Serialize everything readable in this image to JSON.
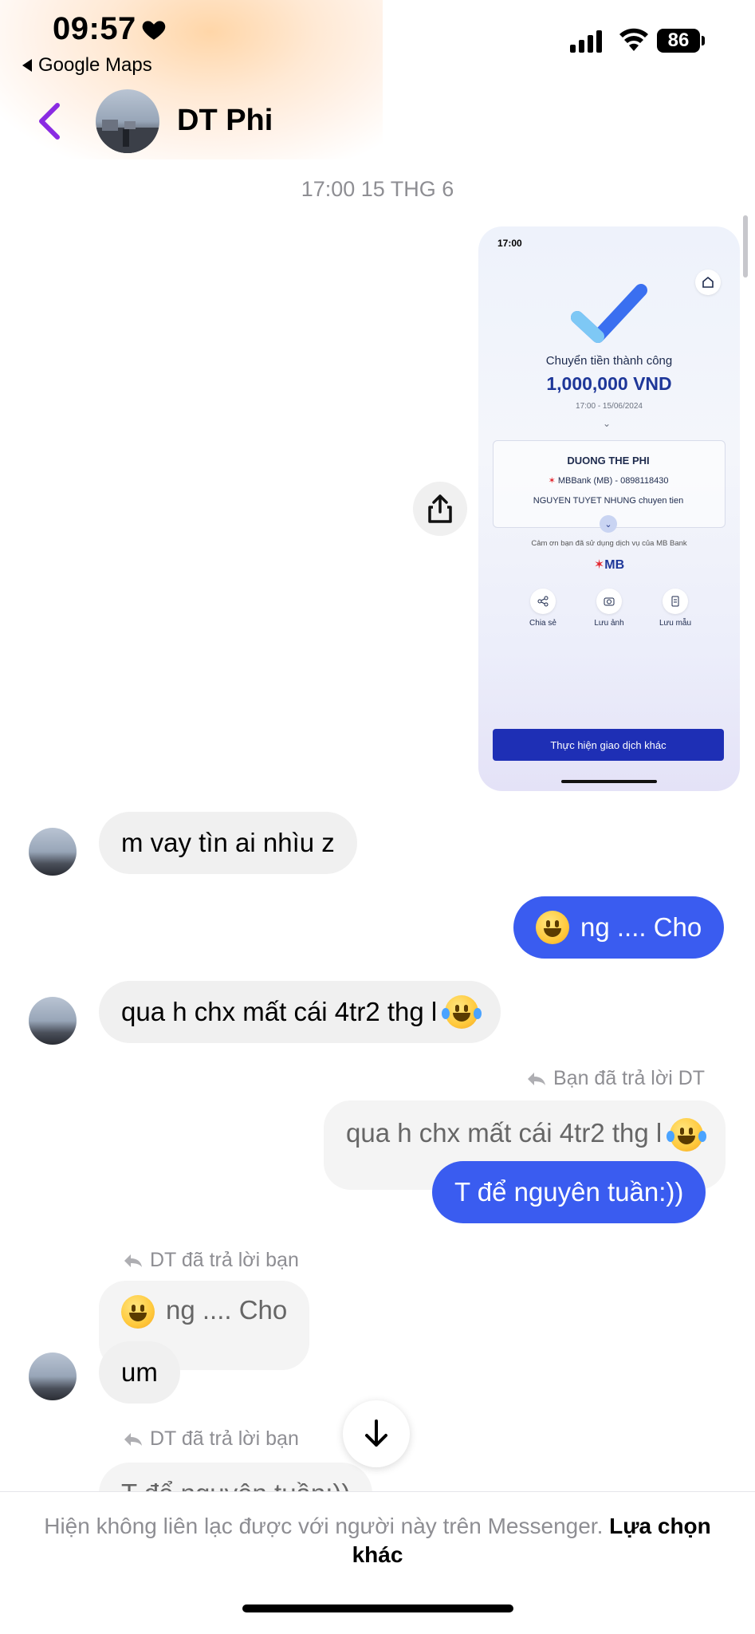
{
  "status_bar": {
    "time": "09:57",
    "back_app": "Google Maps",
    "battery": "86"
  },
  "header": {
    "contact_name": "DT Phi"
  },
  "timestamp": "17:00 15 THG 6",
  "shared_image": {
    "status_time": "17:00",
    "title": "Chuyển tiền thành công",
    "amount": "1,000,000 VND",
    "datetime": "17:00 - 15/06/2024",
    "recipient": "DUONG THE PHI",
    "bank_account": "MBBank (MB) - 0898118430",
    "description": "NGUYEN TUYET NHUNG chuyen tien",
    "thanks": "Cảm ơn bạn đã sử dụng dịch vụ của MB Bank",
    "bank_logo": "MB",
    "actions": [
      "Chia sẻ",
      "Lưu ảnh",
      "Lưu mẫu"
    ],
    "cta": "Thực hiện giao dịch khác"
  },
  "messages": {
    "m1": "m vay tìn ai nhìu z",
    "m2": "ng .... Cho",
    "m3": "qua h chx mất cái 4tr2 thg l",
    "reply1_note": "Bạn đã trả lời DT",
    "reply1_quote": "qua h chx mất cái 4tr2 thg l",
    "m4": "T để nguyên tuần:))",
    "reply2_note": "DT đã trả lời bạn",
    "reply2_quote": "ng .... Cho",
    "m5": "um",
    "reply3_note": "DT đã trả lời bạn",
    "reply3_quote": "T để nguyên tuần:))"
  },
  "footer": {
    "notice": "Hiện không liên lạc được với người này trên Messenger.",
    "link": "Lựa chọn khác"
  },
  "icons": {
    "heart": "heart-icon",
    "back": "chevron-left-icon",
    "share": "share-icon",
    "reply": "reply-arrow-icon",
    "scroll_down": "arrow-down-icon"
  },
  "colors": {
    "accent_purple": "#8a2be2",
    "outgoing_bubble": "#3a5cf0",
    "incoming_bubble": "#f0f0f0"
  }
}
